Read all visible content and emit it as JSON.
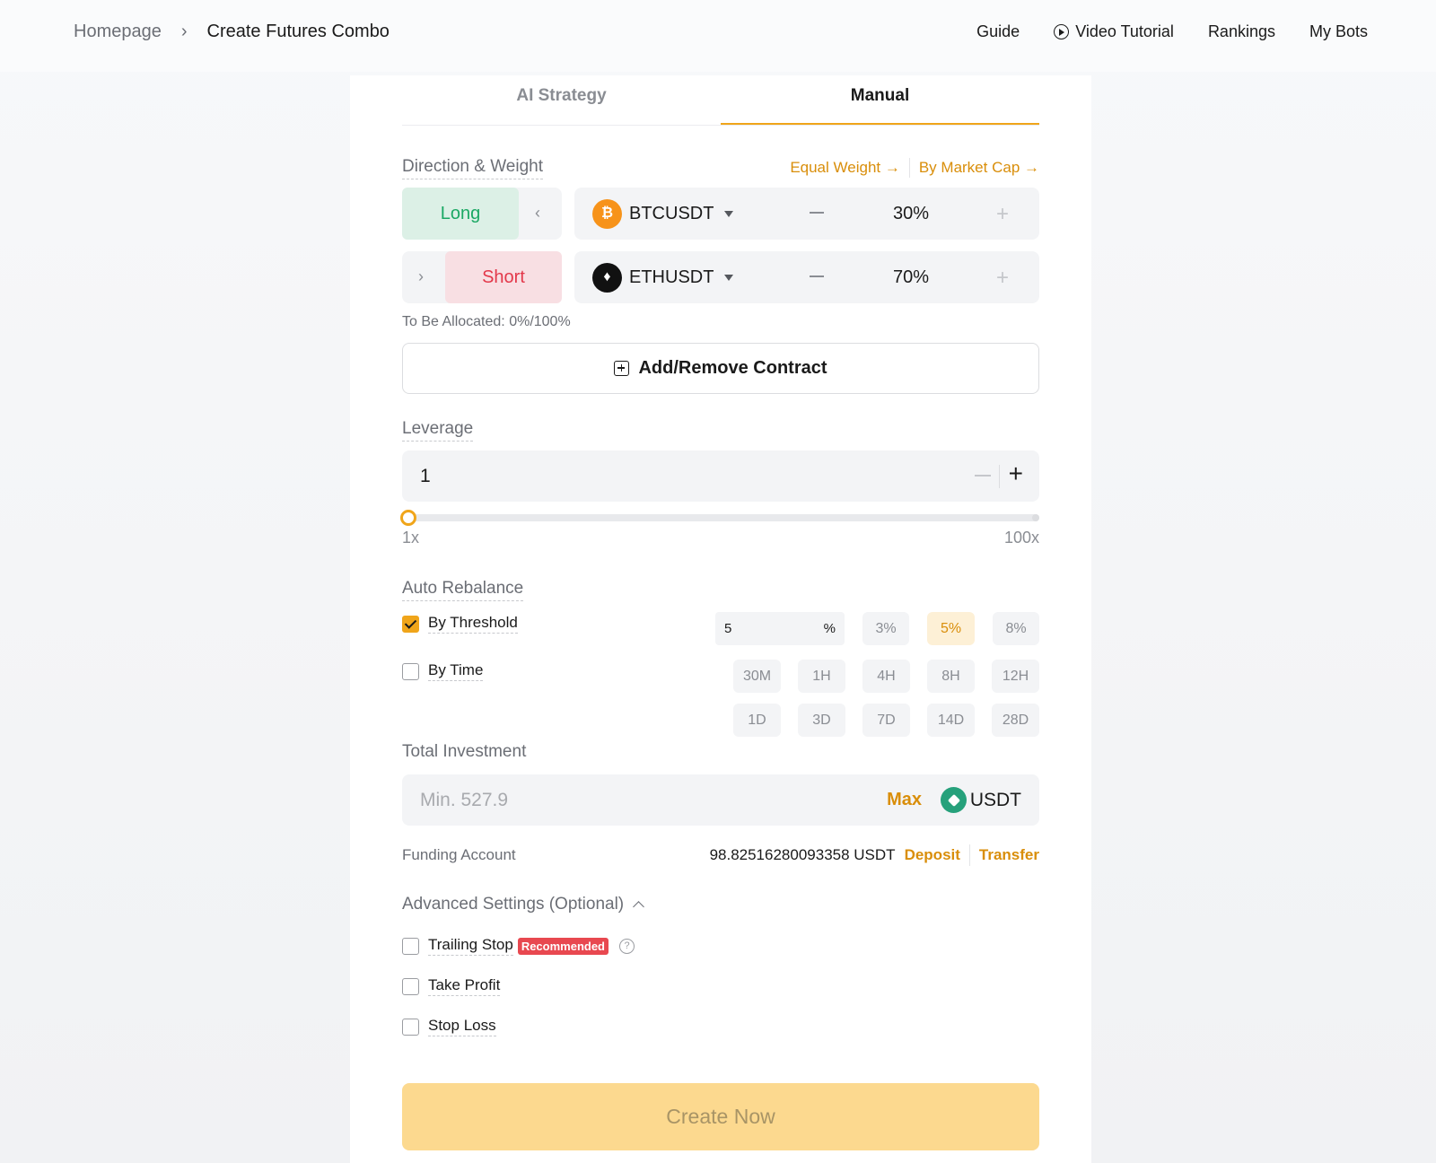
{
  "breadcrumb": {
    "home": "Homepage",
    "separator": "›",
    "current": "Create Futures Combo"
  },
  "topnav": {
    "guide": "Guide",
    "video_tutorial": "Video Tutorial",
    "rankings": "Rankings",
    "my_bots": "My Bots"
  },
  "tabs": [
    {
      "label": "AI Strategy",
      "active": false
    },
    {
      "label": "Manual",
      "active": true
    }
  ],
  "direction_weight": {
    "label": "Direction & Weight",
    "equal_weight": "Equal Weight →",
    "by_market_cap": "By Market Cap →",
    "rows": [
      {
        "direction": "Long",
        "symbol": "BTCUSDT",
        "coin_glyph": "₿",
        "coin_color": "#f7931a",
        "weight": "30%"
      },
      {
        "direction": "Short",
        "symbol": "ETHUSDT",
        "coin_glyph": "♦",
        "coin_color": "#111111",
        "weight": "70%"
      }
    ],
    "to_be_allocated": "To Be Allocated: 0%/100%",
    "add_remove": "Add/Remove Contract"
  },
  "leverage": {
    "label": "Leverage",
    "value": "1",
    "min_label": "1x",
    "max_label": "100x",
    "level": 0
  },
  "auto_rebalance": {
    "label": "Auto Rebalance",
    "by_threshold": {
      "label": "By Threshold",
      "checked": true,
      "input_value": "5",
      "unit": "%",
      "options": [
        "3%",
        "5%",
        "8%"
      ],
      "selected": "5%"
    },
    "by_time": {
      "label": "By Time",
      "checked": false,
      "options": [
        "30M",
        "1H",
        "4H",
        "8H",
        "12H",
        "1D",
        "3D",
        "7D",
        "14D",
        "28D"
      ]
    }
  },
  "total_investment": {
    "label": "Total Investment",
    "placeholder": "Min. 527.9",
    "max": "Max",
    "currency": "USDT"
  },
  "funding": {
    "label": "Funding Account",
    "value": "98.82516280093358 USDT",
    "deposit": "Deposit",
    "transfer": "Transfer"
  },
  "advanced": {
    "label": "Advanced Settings (Optional)",
    "trailing_stop": "Trailing Stop",
    "recommended": "Recommended",
    "help": "?",
    "take_profit": "Take Profit",
    "stop_loss": "Stop Loss"
  },
  "create_button": "Create Now",
  "colors": {
    "accent": "#f0a51a",
    "long": "#1ba864",
    "short": "#e3384a",
    "usdt": "#26a17b"
  }
}
